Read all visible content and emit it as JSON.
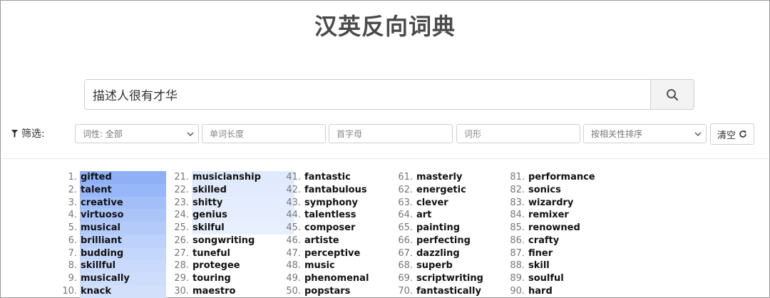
{
  "title": "汉英反向词典",
  "search": {
    "value": "描述人很有才华",
    "button_icon": "search-icon"
  },
  "filters": {
    "label": "筛选:",
    "pos_select": "词性: 全部",
    "length_placeholder": "单词长度",
    "initial_placeholder": "首字母",
    "form_placeholder": "词形",
    "sort_select": "按相关性排序",
    "clear_label": "清空"
  },
  "results": [
    [
      "1.",
      "gifted"
    ],
    [
      "2.",
      "talent"
    ],
    [
      "3.",
      "creative"
    ],
    [
      "4.",
      "virtuoso"
    ],
    [
      "5.",
      "musical"
    ],
    [
      "6.",
      "brilliant"
    ],
    [
      "7.",
      "budding"
    ],
    [
      "8.",
      "skillful"
    ],
    [
      "9.",
      "musically"
    ],
    [
      "10.",
      "knack"
    ],
    [
      "21.",
      "musicianship"
    ],
    [
      "22.",
      "skilled"
    ],
    [
      "23.",
      "shitty"
    ],
    [
      "24.",
      "genius"
    ],
    [
      "25.",
      "skilful"
    ],
    [
      "26.",
      "songwriting"
    ],
    [
      "27.",
      "tuneful"
    ],
    [
      "28.",
      "protegee"
    ],
    [
      "29.",
      "touring"
    ],
    [
      "30.",
      "maestro"
    ],
    [
      "41.",
      "fantastic"
    ],
    [
      "42.",
      "fantabulous"
    ],
    [
      "43.",
      "symphony"
    ],
    [
      "44.",
      "talentless"
    ],
    [
      "45.",
      "composer"
    ],
    [
      "46.",
      "artiste"
    ],
    [
      "47.",
      "perceptive"
    ],
    [
      "48.",
      "music"
    ],
    [
      "49.",
      "phenomenal"
    ],
    [
      "50.",
      "popstars"
    ],
    [
      "61.",
      "masterly"
    ],
    [
      "62.",
      "energetic"
    ],
    [
      "63.",
      "clever"
    ],
    [
      "64.",
      "art"
    ],
    [
      "65.",
      "painting"
    ],
    [
      "66.",
      "perfecting"
    ],
    [
      "67.",
      "dazzling"
    ],
    [
      "68.",
      "superb"
    ],
    [
      "69.",
      "scriptwriting"
    ],
    [
      "70.",
      "fantastically"
    ],
    [
      "81.",
      "performance"
    ],
    [
      "82.",
      "sonics"
    ],
    [
      "83.",
      "wizardry"
    ],
    [
      "84.",
      "remixer"
    ],
    [
      "85.",
      "renowned"
    ],
    [
      "86.",
      "crafty"
    ],
    [
      "87.",
      "finer"
    ],
    [
      "88.",
      "skill"
    ],
    [
      "89.",
      "soulful"
    ],
    [
      "90.",
      "hard"
    ]
  ],
  "highlight_colors": [
    "#8fb0f7",
    "#98b7f8",
    "#a3bff9",
    "#abc5f9",
    "#b4cbfa",
    "#bcd1fb",
    "#c3d6fb",
    "#c9dafc",
    "#ceddfc",
    "#d2e0fc",
    "#e0eafd",
    "#e2ebfd",
    "#e4edfd",
    "#e6eefd",
    "#e8f0fe"
  ]
}
